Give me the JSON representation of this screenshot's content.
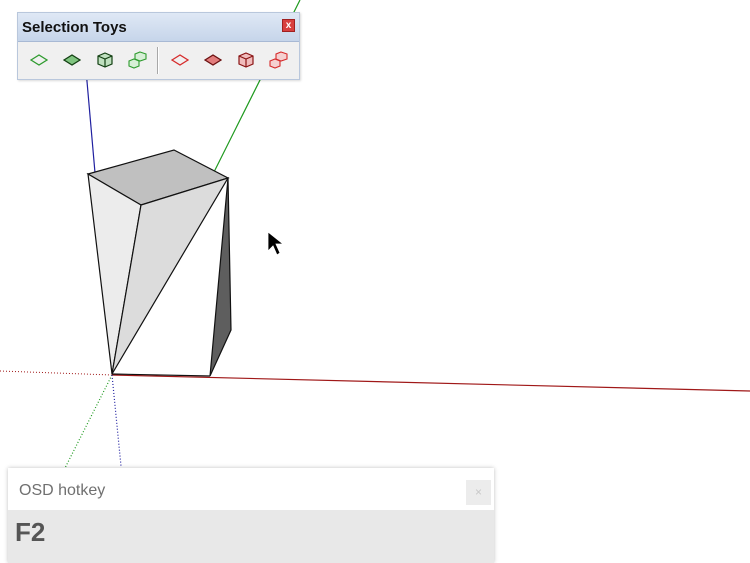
{
  "toolbar": {
    "title": "Selection Toys",
    "close_symbol": "x",
    "buttons": [
      {
        "icon": "select-edges-icon",
        "color": "#2e9b2e"
      },
      {
        "icon": "select-faces-icon",
        "color": "#1a5a1a"
      },
      {
        "icon": "select-groups-icon",
        "color": "#1a5a1a"
      },
      {
        "icon": "select-components-icon",
        "color": "#2e9b2e"
      },
      {
        "icon": "deselect-edges-icon",
        "color": "#d62b2b"
      },
      {
        "icon": "deselect-faces-icon",
        "color": "#b02020"
      },
      {
        "icon": "deselect-groups-icon",
        "color": "#b02020"
      },
      {
        "icon": "deselect-components-icon",
        "color": "#d62b2b"
      }
    ]
  },
  "osd": {
    "title": "OSD hotkey",
    "close_symbol": "×",
    "key": "F2"
  },
  "colors": {
    "red_axis": "#a01818",
    "green_axis": "#1f9a1f",
    "blue_axis": "#2020a0"
  }
}
